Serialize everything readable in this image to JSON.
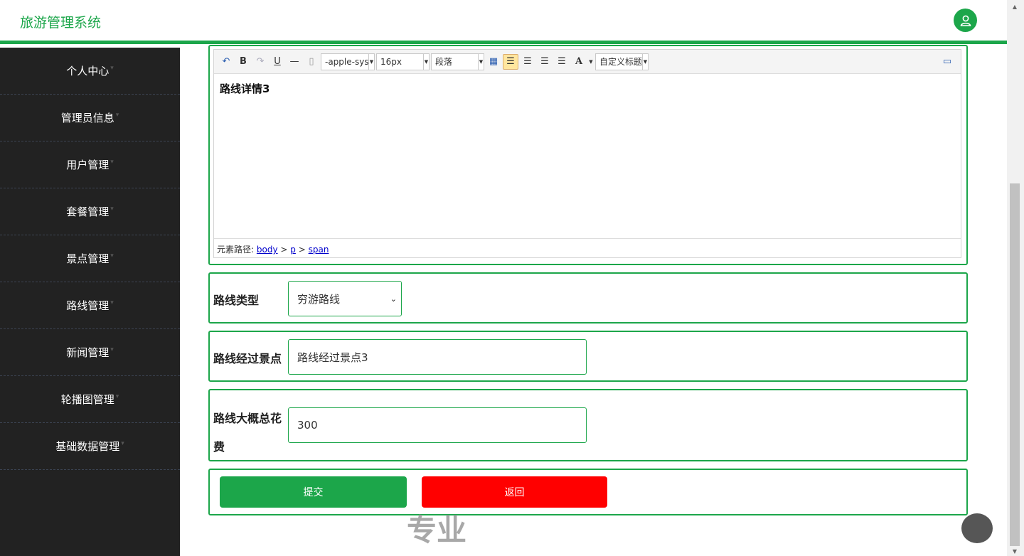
{
  "header": {
    "title": "旅游管理系统",
    "avatar_icon": "user-icon"
  },
  "sidebar": {
    "items": [
      {
        "label": "个人中心"
      },
      {
        "label": "管理员信息"
      },
      {
        "label": "用户管理"
      },
      {
        "label": "套餐管理"
      },
      {
        "label": "景点管理"
      },
      {
        "label": "路线管理"
      },
      {
        "label": "新闻管理"
      },
      {
        "label": "轮播图管理"
      },
      {
        "label": "基础数据管理"
      }
    ]
  },
  "editor": {
    "font_family": "-apple-sys",
    "font_size": "16px",
    "paragraph": "段落",
    "custom_title": "自定义标题",
    "content": "路线详情3",
    "path_label": "元素路径:",
    "path": [
      "body",
      "p",
      "span"
    ]
  },
  "form": {
    "route_type": {
      "label": "路线类型",
      "value": "穷游路线"
    },
    "route_spots": {
      "label": "路线经过景点",
      "value": "路线经过景点3"
    },
    "route_cost": {
      "label_line1": "路线大概总花",
      "label_line2": "费",
      "value": "300"
    }
  },
  "buttons": {
    "submit": "提交",
    "back": "返回"
  },
  "watermark": "专业",
  "colors": {
    "accent": "#1ca64a",
    "danger": "#ff0000",
    "sidebar_bg": "#222222"
  }
}
